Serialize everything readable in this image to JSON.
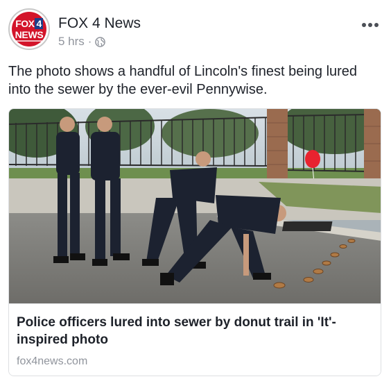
{
  "post": {
    "page_name": "FOX 4 News",
    "time": "5 hrs",
    "separator": "·",
    "privacy_icon": "globe-icon",
    "more_icon": "more-options-icon",
    "text": "The photo shows a handful of Lincoln's finest being lured into the sewer by the ever-evil Pennywise."
  },
  "avatar": {
    "logo_line1_a": "FOX",
    "logo_line1_b": "4",
    "logo_line2": "NEWS",
    "colors": {
      "red": "#d3142a",
      "blue": "#1d3f8a"
    }
  },
  "link_card": {
    "headline": "Police officers lured into sewer by donut trail in 'It'-inspired photo",
    "domain": "fox4news.com"
  },
  "colors": {
    "text": "#1d2129",
    "secondary_text": "#90949c",
    "balloon": "#e8232f"
  }
}
